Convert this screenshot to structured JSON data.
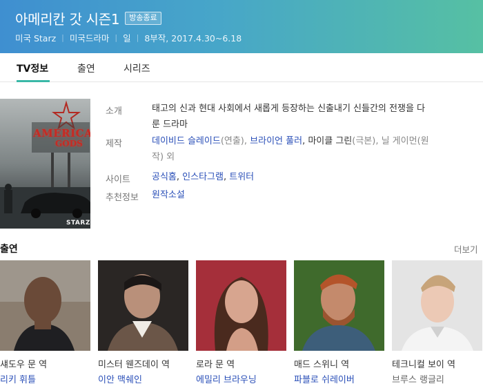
{
  "header": {
    "title": "아메리칸 갓 시즌1",
    "badge": "방송종료",
    "meta": [
      "미국 Starz",
      "미국드라마",
      "일",
      "8부작, 2017.4.30~6.18"
    ]
  },
  "tabs": [
    {
      "label": "TV정보",
      "active": true
    },
    {
      "label": "출연",
      "active": false
    },
    {
      "label": "시리즈",
      "active": false
    }
  ],
  "poster": {
    "sign_line1": "AMERICAN",
    "sign_line2": "GODS",
    "brand": "STARZ"
  },
  "info": {
    "intro_label": "소개",
    "intro_line1": "태고의 신과 현대 사회에서 새롭게 등장하는 신출내기 신들간의 전쟁을 다",
    "intro_line2": "룬 드라마",
    "production_label": "제작",
    "production": {
      "director1": "데이비드 슬레이드",
      "director1_role": "(연출), ",
      "director2": "브라이언 풀러",
      "sep": ", 마이클 그린",
      "writer_role": "(극본), 닐 게이먼",
      "tail_line1": "(원",
      "tail_line2": "작) 외"
    },
    "site_label": "사이트",
    "sites": [
      "공식홈",
      "인스타그램",
      "트위터"
    ],
    "site_sep": ", ",
    "recommend_label": "추천정보",
    "recommend": "원작소설"
  },
  "cast": {
    "heading": "출연",
    "more": "더보기",
    "items": [
      {
        "role": "섀도우 문 역",
        "actor": "리키 휘틀",
        "actor_link": true
      },
      {
        "role": "미스터 웬즈데이 역",
        "actor": "이안 맥쉐인",
        "actor_link": true
      },
      {
        "role": "로라 문 역",
        "actor": "에밀리 브라우닝",
        "actor_link": true
      },
      {
        "role": "매드 스위니 역",
        "actor": "파블로 쉬레이버",
        "actor_link": true
      },
      {
        "role": "테크니컬 보이 역",
        "actor": "브루스 랭글리",
        "actor_link": false
      }
    ]
  },
  "colors": {
    "accent": "#3ab8a7",
    "link": "#2a4fb8",
    "banner_start": "#3f8fd0",
    "banner_end": "#56c0a3"
  }
}
